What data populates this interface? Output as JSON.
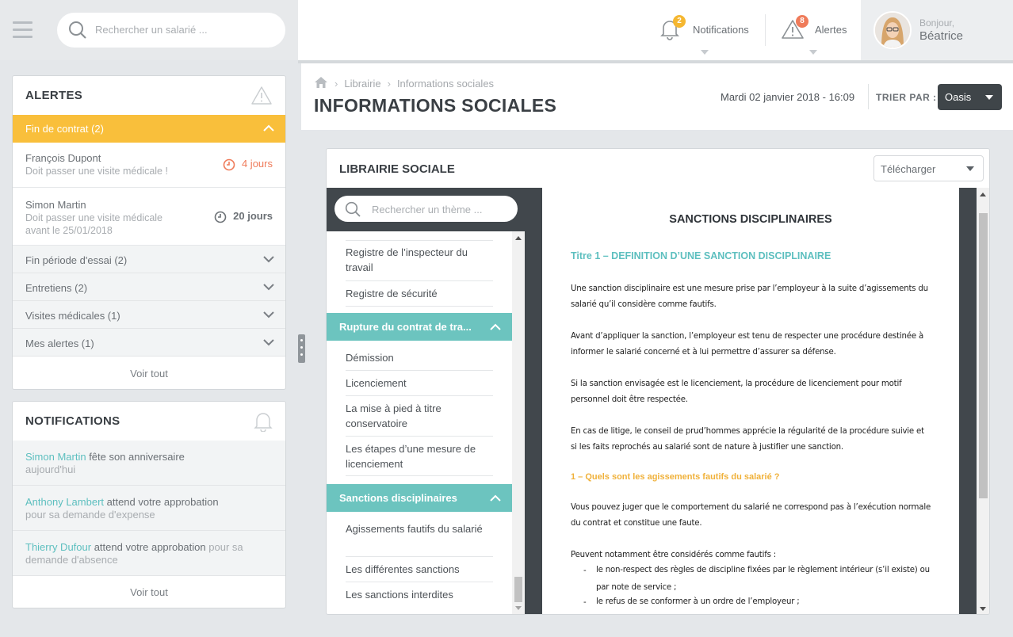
{
  "topbar": {
    "search_placeholder": "Rechercher un salarié ...",
    "notifications": {
      "label": "Notifications",
      "count": "2",
      "color": "#f5b731"
    },
    "alertes": {
      "label": "Alertes",
      "count": "8",
      "color": "#ef7b5a"
    },
    "user": {
      "greeting": "Bonjour,",
      "name": "Béatrice"
    }
  },
  "alerts_panel": {
    "title": "ALERTES",
    "active_group": "Fin de contrat (2)",
    "items": [
      {
        "name": "François Dupont",
        "desc": "Doit passer une visite médicale !",
        "days": "4 jours",
        "color": "#ef7b5a"
      },
      {
        "name": "Simon Martin",
        "desc": "Doit passer une visite médicale avant le 25/01/2018",
        "days": "20 jours",
        "color": "#6b7075"
      }
    ],
    "groups": [
      "Fin période d'essai (2)",
      "Entretiens (2)",
      "Visites médicales (1)",
      "Mes alertes (1)"
    ],
    "see_all": "Voir tout"
  },
  "notifications_panel": {
    "title": "NOTIFICATIONS",
    "items": [
      {
        "who": "Simon Martin",
        "text": " fête son anniversaire",
        "muted": "aujourd'hui"
      },
      {
        "who": "Anthony Lambert",
        "text": " attend votre approbation",
        "muted": "pour sa demande d'expense"
      },
      {
        "who": "Thierry Dufour",
        "text": " attend votre approbation",
        "muted": " pour sa demande d'absence"
      }
    ],
    "see_all": "Voir tout"
  },
  "header": {
    "breadcrumb": [
      "Librairie",
      "Informations sociales"
    ],
    "title": "INFORMATIONS SOCIALES",
    "date": "Mardi 02 janvier 2018 - 16:09",
    "sort_label": "TRIER PAR :",
    "sort_value": "Oasis"
  },
  "library": {
    "title": "LIBRAIRIE SOCIALE",
    "download_label": "Télécharger",
    "theme_search_placeholder": "Rechercher un thème ...",
    "items_top": [
      "Registre de l’inspecteur du travail",
      "Registre de sécurité"
    ],
    "group1": "Rupture du contrat de tra...",
    "group1_items": [
      "Démission",
      "Licenciement",
      "La mise à pied à titre conservatoire",
      "Les étapes d’une mesure de licenciement"
    ],
    "group2": "Sanctions disciplinaires",
    "group2_items": [
      "Agissements fautifs du salarié",
      "Les différentes sanctions",
      "Les sanctions interdites"
    ]
  },
  "document": {
    "title": "SANCTIONS DISCIPLINAIRES",
    "heading1": "Titre 1 – DEFINITION D’UNE SANCTION DISCIPLINAIRE",
    "paragraphs": [
      "Une sanction disciplinaire est une mesure prise par l’employeur à la suite d’agissements du salarié qu’il considère comme fautifs.",
      "Avant d’appliquer la sanction, l’employeur est tenu de respecter une procédure destinée à informer le salarié concerné et à lui permettre d’assurer sa défense.",
      "Si la sanction envisagée est le licenciement, la procédure de licenciement pour motif personnel doit être respectée.",
      "En cas de litige, le conseil de prud’hommes apprécie la régularité de la procédure suivie et si les faits reprochés au salarié sont de nature à justifier une sanction."
    ],
    "heading2": "1 – Quels sont les agissements fautifs du salarié ?",
    "paragraph5": "Vous pouvez juger que le comportement du salarié ne correspond pas à l’exécution normale du contrat et constitue une faute.",
    "paragraph6": "Peuvent notamment être considérés comme fautifs :",
    "bullets": [
      "le non-respect des règles de discipline fixées par le règlement intérieur (s’il existe) ou par note de service ;",
      "le refus de se conformer à un ordre de l’employeur ;"
    ]
  }
}
